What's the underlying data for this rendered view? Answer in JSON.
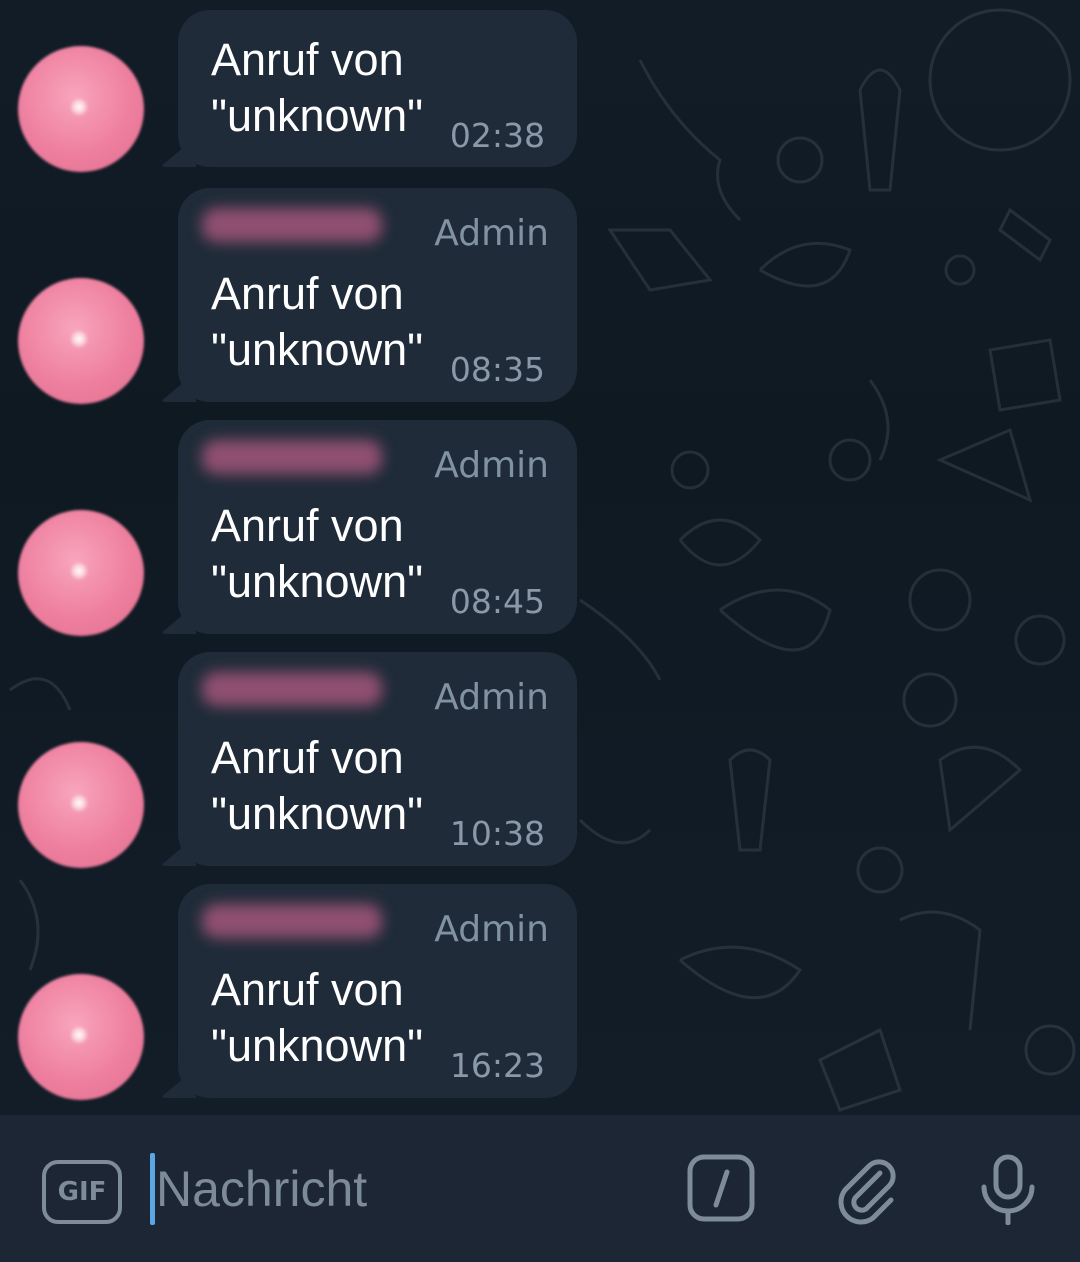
{
  "messages": [
    {
      "role_label": "",
      "text": "Anruf von\n\"unknown\"",
      "time": "02:38"
    },
    {
      "role_label": "Admin",
      "text": "Anruf von\n\"unknown\"",
      "time": "08:35"
    },
    {
      "role_label": "Admin",
      "text": "Anruf von\n\"unknown\"",
      "time": "08:45"
    },
    {
      "role_label": "Admin",
      "text": "Anruf von\n\"unknown\"",
      "time": "10:38"
    },
    {
      "role_label": "Admin",
      "text": "Anruf von\n\"unknown\"",
      "time": "16:23"
    }
  ],
  "composer": {
    "gif_label": "GIF",
    "placeholder": "Nachricht",
    "icons": {
      "gif": "gif-icon",
      "commands": "slash-command-icon",
      "attach": "paperclip-icon",
      "voice": "microphone-icon"
    }
  },
  "colors": {
    "background": "#0f1822",
    "bubble": "#1f2b38",
    "avatar": "#ee7f9f",
    "accent": "#5aa7e6",
    "muted_text": "#8192a3"
  }
}
